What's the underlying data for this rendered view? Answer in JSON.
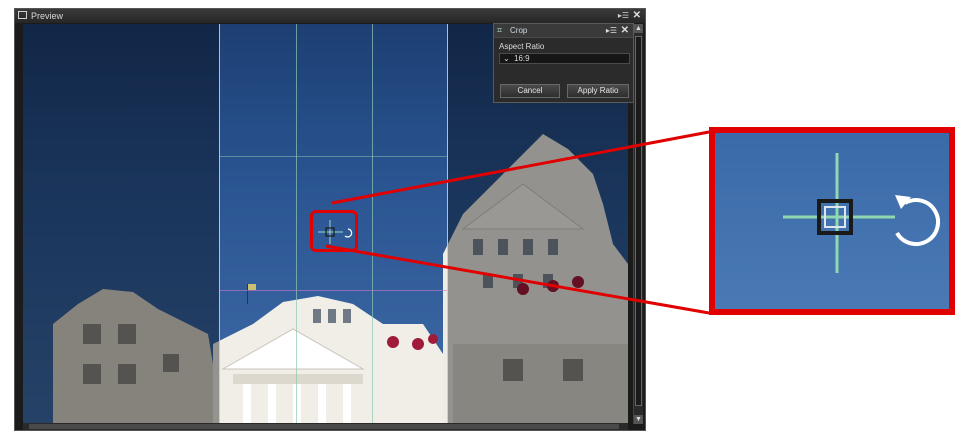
{
  "window": {
    "title": "Preview",
    "menu_glyph": "▸☰",
    "close_glyph": "✕"
  },
  "crop_panel": {
    "title": "Crop",
    "menu_glyph": "▸☰",
    "close_glyph": "✕",
    "aspect_ratio_label": "Aspect Ratio",
    "aspect_ratio_value": "16:9",
    "cancel_label": "Cancel",
    "apply_label": "Apply Ratio"
  },
  "colors": {
    "callout_red": "#e00000",
    "grid_green": "#8cc8b4",
    "sky_blue": "#2a5592",
    "panel_bg": "#2b2b2b"
  },
  "icons": {
    "crop": "crop-icon",
    "move_handle": "move-handle-icon",
    "rotate": "rotate-icon",
    "chevron": "chevron-down-icon"
  }
}
